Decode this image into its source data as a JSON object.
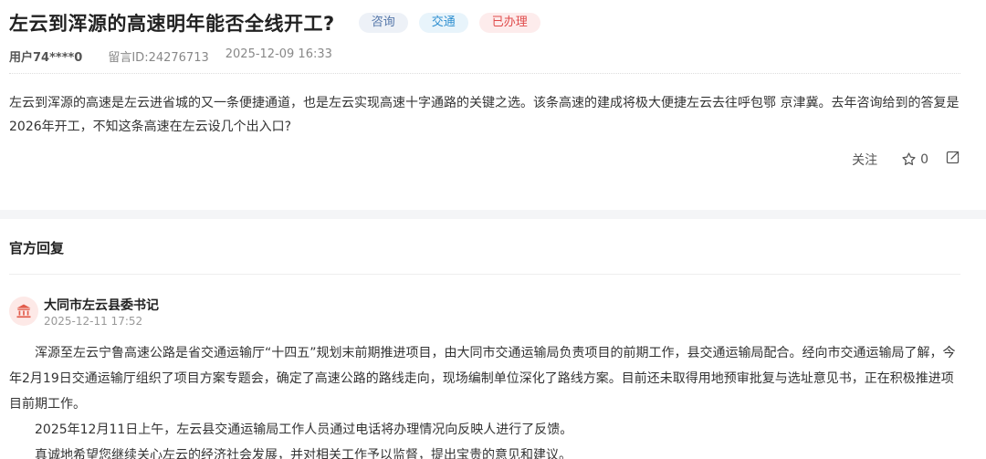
{
  "question": {
    "title": "左云到浑源的高速明年能否全线开工?",
    "tags": [
      "咨询",
      "交通",
      "已办理"
    ],
    "user": "用户74****0",
    "message_id": "留言ID:24276713",
    "datetime": "2025-12-09 16:33",
    "content": "左云到浑源的高速是左云进省城的又一条便捷通道，也是左云实现高速十字通路的关键之选。该条高速的建成将极大便捷左云去往呼包鄂 京津冀。去年咨询给到的答复是2026年开工，不知这条高速在左云设几个出入口?",
    "actions": {
      "follow_label": "关注",
      "like_count": "0"
    }
  },
  "reply": {
    "section_title": "官方回复",
    "org_name": "大同市左云县委书记",
    "datetime": "2025-12-11 17:52",
    "paragraphs": [
      "浑源至左云宁鲁高速公路是省交通运输厅“十四五”规划末前期推进项目，由大同市交通运输局负责项目的前期工作，县交通运输局配合。经向市交通运输局了解，今年2月19日交通运输厅组织了项目方案专题会，确定了高速公路的路线走向，现场编制单位深化了路线方案。目前还未取得用地预审批复与选址意见书，正在积极推进项目前期工作。",
      "2025年12月11日上午，左云县交通运输局工作人员通过电话将办理情况向反映人进行了反馈。",
      "真诚地希望您继续关心左云的经济社会发展，并对相关工作予以监督，提出宝贵的意见和建议。"
    ]
  },
  "icons": {
    "like": "star-outline-icon",
    "share": "share-icon",
    "org": "government-building-icon"
  },
  "colors": {
    "tag_consult": "#5577aa",
    "tag_traffic": "#2f8fd0",
    "tag_done": "#e04b4b",
    "org_icon": "#e25b4a"
  }
}
